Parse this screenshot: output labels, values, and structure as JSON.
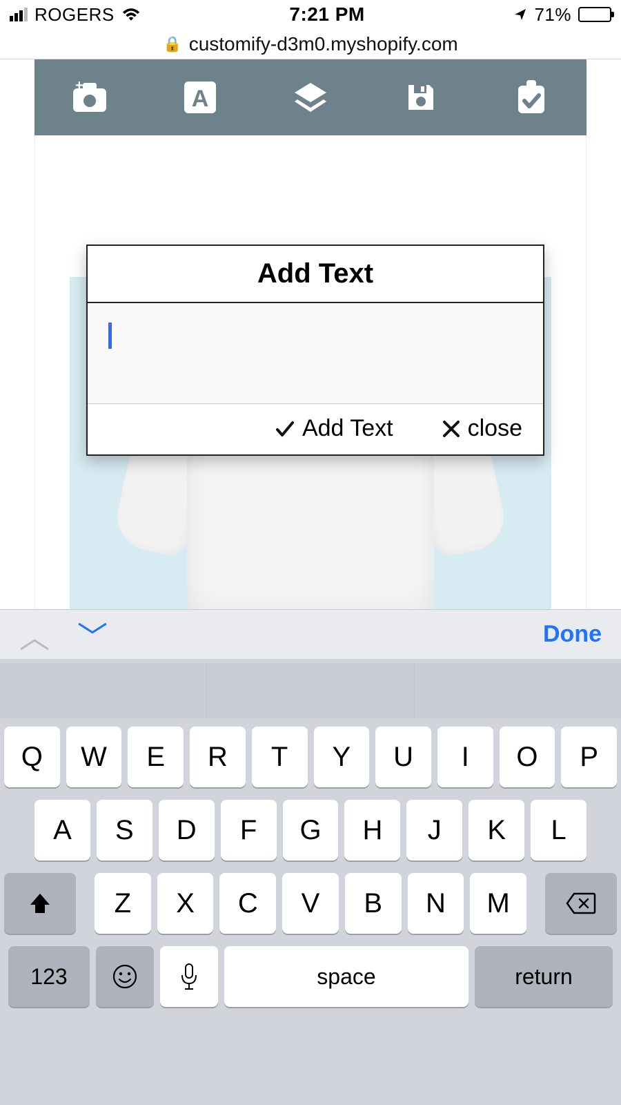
{
  "status": {
    "carrier": "ROGERS",
    "time": "7:21 PM",
    "battery_pct": "71%"
  },
  "browser": {
    "url": "customify-d3m0.myshopify.com"
  },
  "toolbar": {
    "items": [
      "camera",
      "text",
      "layers",
      "save",
      "done"
    ]
  },
  "modal": {
    "title": "Add Text",
    "input_value": "",
    "confirm_label": "Add Text",
    "close_label": "close"
  },
  "kbd_accessory": {
    "done": "Done"
  },
  "keyboard": {
    "row1": [
      "Q",
      "W",
      "E",
      "R",
      "T",
      "Y",
      "U",
      "I",
      "O",
      "P"
    ],
    "row2": [
      "A",
      "S",
      "D",
      "F",
      "G",
      "H",
      "J",
      "K",
      "L"
    ],
    "row3": [
      "Z",
      "X",
      "C",
      "V",
      "B",
      "N",
      "M"
    ],
    "numbers": "123",
    "space": "space",
    "return": "return"
  }
}
